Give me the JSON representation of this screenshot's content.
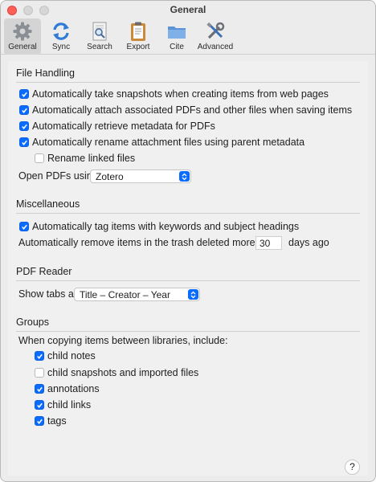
{
  "window": {
    "title": "General"
  },
  "toolbar": {
    "tabs": [
      {
        "label": "General",
        "icon": "gear-icon",
        "active": true
      },
      {
        "label": "Sync",
        "icon": "sync-icon"
      },
      {
        "label": "Search",
        "icon": "search-icon"
      },
      {
        "label": "Export",
        "icon": "clipboard-icon"
      },
      {
        "label": "Cite",
        "icon": "folder-icon"
      },
      {
        "label": "Advanced",
        "icon": "tools-icon"
      }
    ]
  },
  "file_handling": {
    "title": "File Handling",
    "snapshots": {
      "label": "Automatically take snapshots when creating items from web pages",
      "checked": true
    },
    "attach_pdfs": {
      "label": "Automatically attach associated PDFs and other files when saving items",
      "checked": true
    },
    "retrieve_metadata": {
      "label": "Automatically retrieve metadata for PDFs",
      "checked": true
    },
    "rename_attachments": {
      "label": "Automatically rename attachment files using parent metadata",
      "checked": true
    },
    "rename_linked": {
      "label": "Rename linked files",
      "checked": false
    },
    "open_pdfs": {
      "label": "Open PDFs using",
      "value": "Zotero"
    }
  },
  "miscellaneous": {
    "title": "Miscellaneous",
    "auto_tag": {
      "label": "Automatically tag items with keywords and subject headings",
      "checked": true
    },
    "trash": {
      "label_before": "Automatically remove items in the trash deleted more than",
      "value": "30",
      "label_after": "days ago"
    }
  },
  "pdf_reader": {
    "title": "PDF Reader",
    "show_tabs": {
      "label": "Show tabs as",
      "value": "Title – Creator – Year"
    }
  },
  "groups": {
    "title": "Groups",
    "intro": "When copying items between libraries, include:",
    "child_notes": {
      "label": "child notes",
      "checked": true
    },
    "child_snapshots": {
      "label": "child snapshots and imported files",
      "checked": false
    },
    "annotations": {
      "label": "annotations",
      "checked": true
    },
    "child_links": {
      "label": "child links",
      "checked": true
    },
    "tags": {
      "label": "tags",
      "checked": true
    }
  },
  "help": {
    "label": "?"
  },
  "colors": {
    "accent": "#0a6cff",
    "window_bg": "#ececec",
    "content_bg": "#f0f0f0"
  }
}
